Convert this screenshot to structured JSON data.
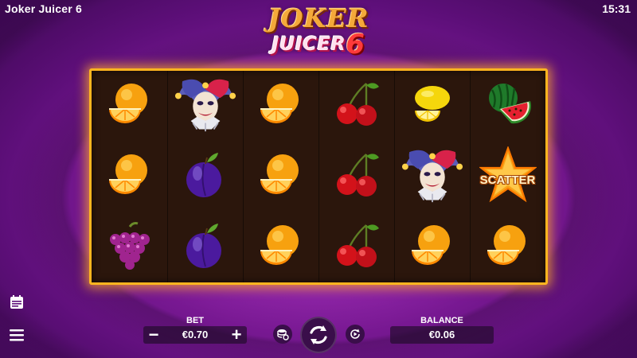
{
  "header": {
    "game_title": "Joker Juicer 6",
    "clock": "15:31"
  },
  "logo": {
    "line1": "JOKER",
    "line2": "JUICER",
    "number": "6"
  },
  "reels": {
    "columns": [
      [
        "orange",
        "orange",
        "grapes"
      ],
      [
        "joker",
        "plum",
        "plum"
      ],
      [
        "orange",
        "orange",
        "orange"
      ],
      [
        "cherries",
        "cherries",
        "cherries"
      ],
      [
        "lemon",
        "joker",
        "orange"
      ],
      [
        "watermelon",
        "scatter",
        "orange"
      ]
    ],
    "scatter_label": "SCATTER"
  },
  "controls": {
    "bet_label": "BET",
    "bet_value": "€0.70",
    "balance_label": "BALANCE",
    "balance_value": "€0.06",
    "minus_symbol": "−",
    "plus_symbol": "+"
  },
  "icons": {
    "paytable": "paytable-icon",
    "menu": "menu-icon",
    "coins": "coins-icon",
    "spin": "spin-icon",
    "autoplay": "autoplay-icon"
  },
  "colors": {
    "frame_border": "#ffb51f",
    "background": "#8a1fa3",
    "reel_bg": "#2b160c"
  }
}
